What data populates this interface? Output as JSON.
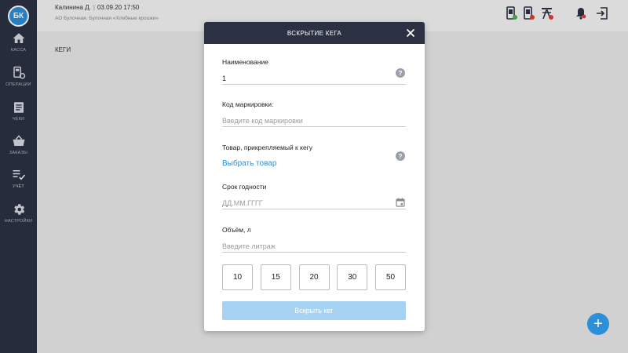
{
  "app": {
    "logo_text": "БК"
  },
  "sidebar": {
    "items": [
      {
        "label": "КАССА",
        "icon": "home-icon"
      },
      {
        "label": "ОПЕРАЦИИ",
        "icon": "operations-icon"
      },
      {
        "label": "ЧЕКИ",
        "icon": "receipt-icon"
      },
      {
        "label": "ЗАКАЗЫ",
        "icon": "basket-icon"
      },
      {
        "label": "УЧЁТ",
        "icon": "accounting-icon"
      },
      {
        "label": "НАСТРОЙКИ",
        "icon": "gear-icon"
      }
    ],
    "active_index": 4
  },
  "header": {
    "user": "Калинина Д.",
    "datetime": "03.09.20 17:50",
    "org": "АО Булочная. Булочная «Хлебные крошки»",
    "status_colors": {
      "ok": "#4caf50",
      "error": "#e53935"
    }
  },
  "page": {
    "title": "КЕГИ"
  },
  "modal": {
    "title": "ВСКРЫТИЕ КЕГА",
    "name_label": "Наименование",
    "name_value": "1",
    "marking_label": "Код маркировки:",
    "marking_placeholder": "Введите код маркировки",
    "product_label": "Товар, прикрепляемый к кегу",
    "product_link": "Выбрать товар",
    "expiry_label": "Срок годности",
    "expiry_placeholder": "ДД.ММ.ГГГГ",
    "volume_label": "Объём, л",
    "volume_placeholder": "Введите литраж",
    "volume_options": [
      "10",
      "15",
      "20",
      "30",
      "50"
    ],
    "submit_label": "Вскрыть кег"
  },
  "fab": {
    "label": "+"
  },
  "colors": {
    "sidebar": "#2b3142",
    "accent": "#2d8fd8",
    "submit_disabled": "#a6d3f3"
  }
}
